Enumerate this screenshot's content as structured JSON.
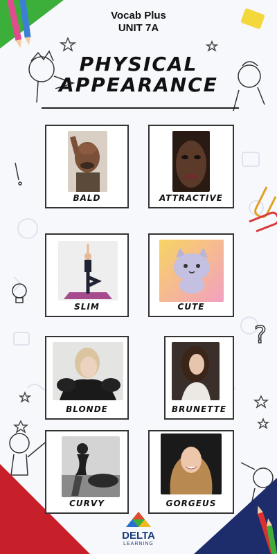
{
  "header": {
    "line1": "Vocab Plus",
    "line2": "UNIT 7A"
  },
  "title": {
    "line1": "PHYSICAL",
    "line2": "APPEARANCE"
  },
  "cards": [
    {
      "label": "BALD",
      "image": "bald-man-photo"
    },
    {
      "label": "ATTRACTIVE",
      "image": "attractive-woman-photo"
    },
    {
      "label": "SLIM",
      "image": "slim-yoga-figure"
    },
    {
      "label": "CUTE",
      "image": "cute-cat-cartoon"
    },
    {
      "label": "BLONDE",
      "image": "blonde-woman-photo"
    },
    {
      "label": "BRUNETTE",
      "image": "brunette-woman-photo"
    },
    {
      "label": "CURVY",
      "image": "curvy-woman-photo"
    },
    {
      "label": "GORGEUS",
      "image": "gorgeous-woman-photo"
    }
  ],
  "logo": {
    "name": "DELTA",
    "subtitle": "LEARNING"
  },
  "colors": {
    "pencil_green": "#3cae3a",
    "corner_red": "#c8202a",
    "corner_navy": "#1d2d6b",
    "logo_blue": "#163a7a"
  }
}
